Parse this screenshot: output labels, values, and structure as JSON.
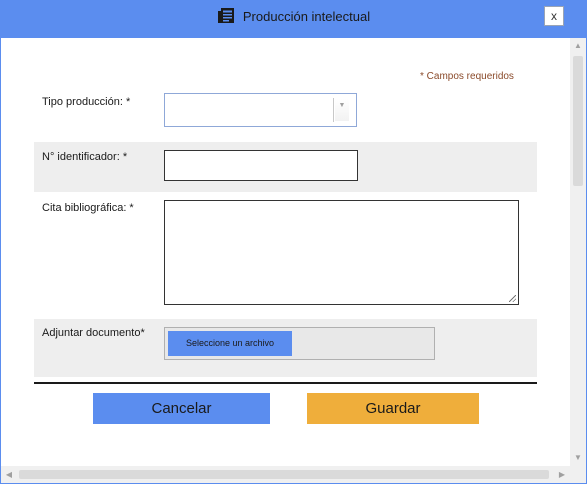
{
  "dialog": {
    "title": "Producción intelectual",
    "title_icon": "newspaper-icon",
    "close_label": "x"
  },
  "form": {
    "required_note": "* Campos requeridos",
    "tipo_produccion": {
      "label": "Tipo producción: *",
      "value": ""
    },
    "identificador": {
      "label": "N° identificador: *",
      "value": ""
    },
    "cita": {
      "label": "Cita bibliográfica: *",
      "value": ""
    },
    "adjuntar": {
      "label": "Adjuntar documento*",
      "button_label": "Seleccione un archivo"
    }
  },
  "actions": {
    "cancel_label": "Cancelar",
    "save_label": "Guardar"
  },
  "colors": {
    "accent_blue": "#5b8def",
    "save_orange": "#efae3b",
    "required_note": "#8a4a2a",
    "row_gray": "#eeeeee"
  }
}
